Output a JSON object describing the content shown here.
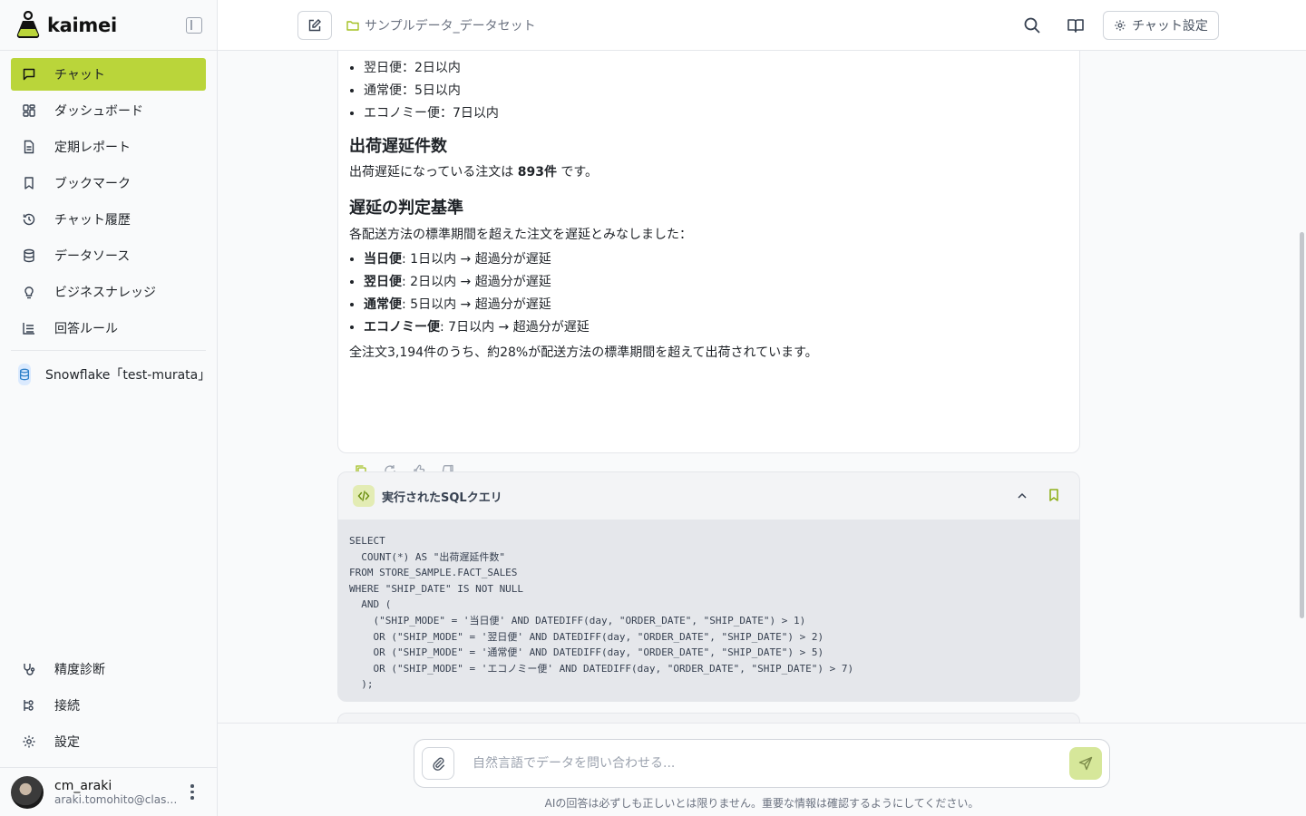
{
  "app": {
    "name": "kaimei"
  },
  "sidebar": {
    "items": [
      {
        "label": "チャット",
        "icon": "chat-icon"
      },
      {
        "label": "ダッシュボード",
        "icon": "dashboard-icon"
      },
      {
        "label": "定期レポート",
        "icon": "report-icon"
      },
      {
        "label": "ブックマーク",
        "icon": "bookmark-icon"
      },
      {
        "label": "チャット履歴",
        "icon": "history-icon"
      },
      {
        "label": "データソース",
        "icon": "database-icon"
      },
      {
        "label": "ビジネスナレッジ",
        "icon": "lightbulb-icon"
      },
      {
        "label": "回答ルール",
        "icon": "rules-icon"
      }
    ],
    "datasource": "Snowflake「test-murata」",
    "bottom_items": [
      {
        "label": "精度診断",
        "icon": "stethoscope-icon"
      },
      {
        "label": "接続",
        "icon": "connection-icon"
      },
      {
        "label": "設定",
        "icon": "gear-icon"
      }
    ],
    "user": {
      "name": "cm_araki",
      "email": "araki.tomohito@classmethod.jp"
    }
  },
  "header": {
    "dataset": "サンプルデータ_データセット",
    "settings_label": "チャット設定"
  },
  "answer": {
    "top_bullets": [
      "翌日便：2日以内",
      "通常便：5日以内",
      "エコノミー便：7日以内"
    ],
    "h_count": "出荷遅延件数",
    "count_pre": "出荷遅延になっている注文は ",
    "count_value": "893件",
    "count_post": " です。",
    "h_criteria": "遅延の判定基準",
    "criteria_intro": "各配送方法の標準期間を超えた注文を遅延とみなしました：",
    "criteria": [
      {
        "mode": "当日便",
        "rule": ": 1日以内 → 超過分が遅延"
      },
      {
        "mode": "翌日便",
        "rule": ": 2日以内 → 超過分が遅延"
      },
      {
        "mode": "通常便",
        "rule": ": 5日以内 → 超過分が遅延"
      },
      {
        "mode": "エコノミー便",
        "rule": ": 7日以内 → 超過分が遅延"
      }
    ],
    "summary": "全注文3,194件のうち、約28%が配送方法の標準期間を超えて出荷されています。"
  },
  "sql": {
    "title": "実行されたSQLクエリ",
    "code": "SELECT\n  COUNT(*) AS \"出荷遅延件数\"\nFROM STORE_SAMPLE.FACT_SALES\nWHERE \"SHIP_DATE\" IS NOT NULL\n  AND (\n    (\"SHIP_MODE\" = '当日便' AND DATEDIFF(day, \"ORDER_DATE\", \"SHIP_DATE\") > 1)\n    OR (\"SHIP_MODE\" = '翌日便' AND DATEDIFF(day, \"ORDER_DATE\", \"SHIP_DATE\") > 2)\n    OR (\"SHIP_MODE\" = '通常便' AND DATEDIFF(day, \"ORDER_DATE\", \"SHIP_DATE\") > 5)\n    OR (\"SHIP_MODE\" = 'エコノミー便' AND DATEDIFF(day, \"ORDER_DATE\", \"SHIP_DATE\") > 7)\n  );"
  },
  "input": {
    "placeholder": "自然言語でデータを問い合わせる...",
    "disclaimer": "AIの回答は必ずしも正しいとは限りません。重要な情報は確認するようにしてください。"
  },
  "colors": {
    "accent": "#bad53a",
    "accent_light": "#d6e79a"
  }
}
